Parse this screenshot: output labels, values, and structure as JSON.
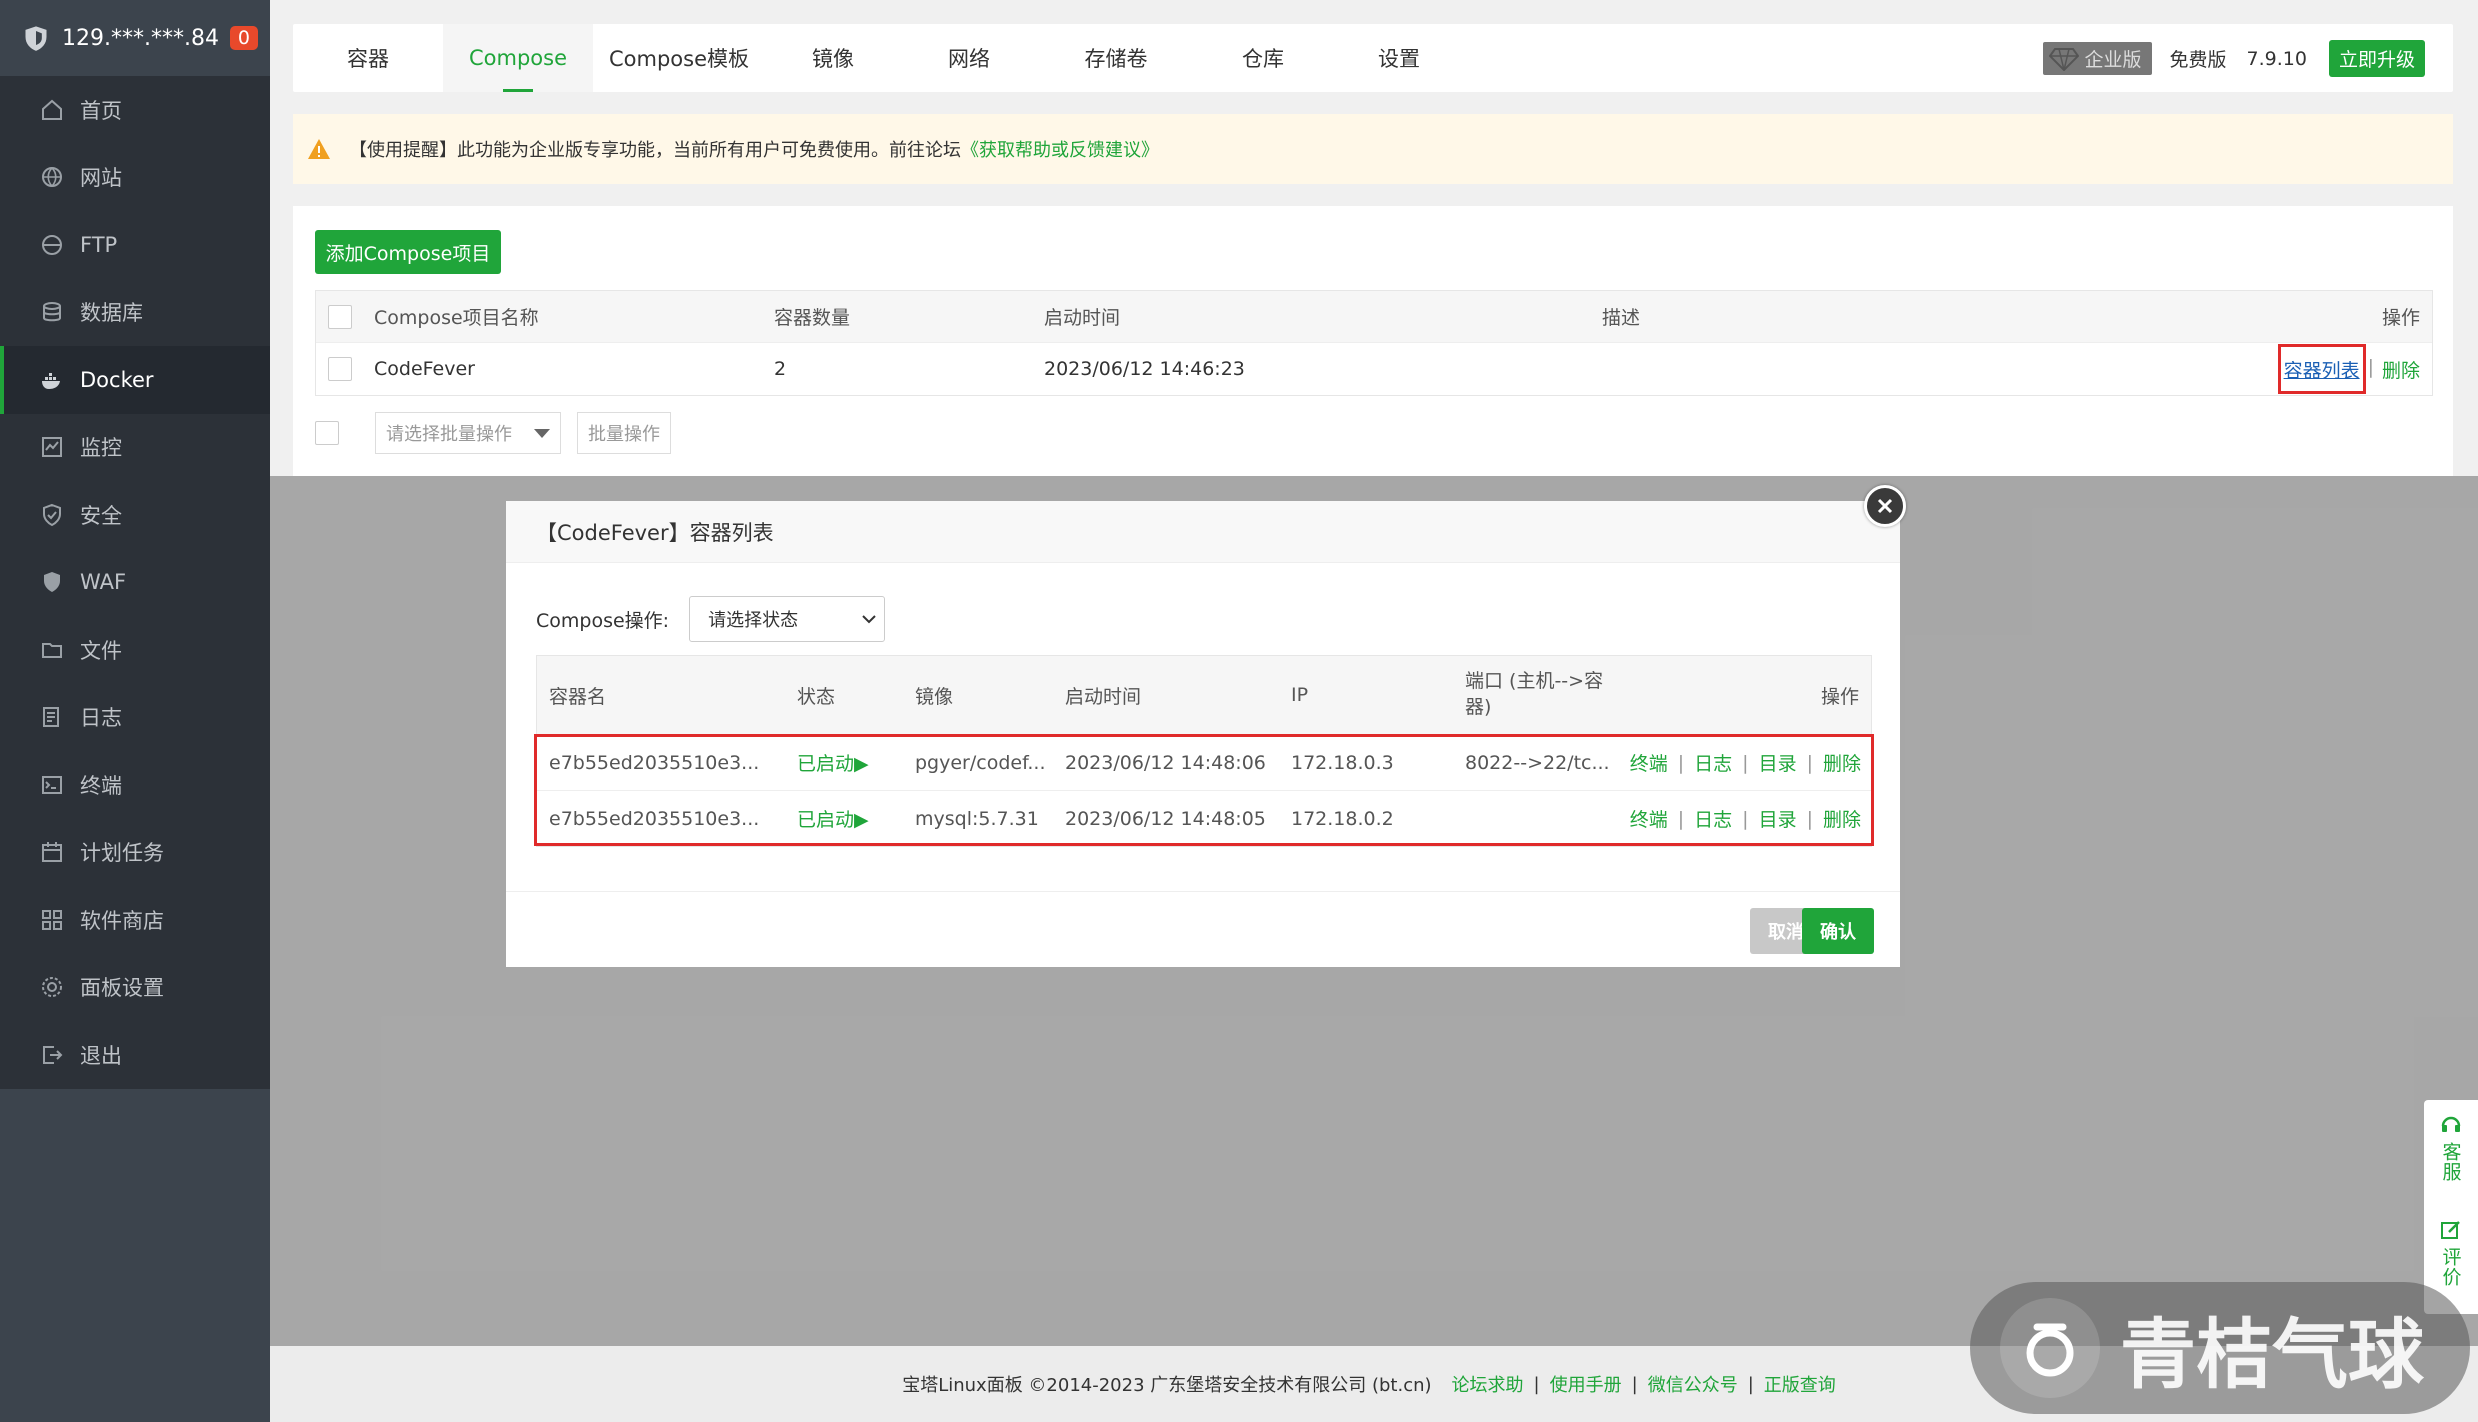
{
  "sidebar": {
    "server_ip": "129.***.***.84",
    "badge": "0",
    "items": [
      {
        "label": "首页",
        "icon": "home-icon"
      },
      {
        "label": "网站",
        "icon": "globe-icon"
      },
      {
        "label": "FTP",
        "icon": "ftp-icon"
      },
      {
        "label": "数据库",
        "icon": "database-icon"
      },
      {
        "label": "Docker",
        "icon": "docker-icon"
      },
      {
        "label": "监控",
        "icon": "monitor-icon"
      },
      {
        "label": "安全",
        "icon": "shield-check-icon"
      },
      {
        "label": "WAF",
        "icon": "waf-shield-icon"
      },
      {
        "label": "文件",
        "icon": "folder-icon"
      },
      {
        "label": "日志",
        "icon": "log-icon"
      },
      {
        "label": "终端",
        "icon": "terminal-icon"
      },
      {
        "label": "计划任务",
        "icon": "calendar-icon"
      },
      {
        "label": "软件商店",
        "icon": "apps-icon"
      },
      {
        "label": "面板设置",
        "icon": "settings-icon"
      },
      {
        "label": "退出",
        "icon": "logout-icon"
      }
    ],
    "active_index": 4
  },
  "tabs": [
    {
      "label": "容器"
    },
    {
      "label": "Compose"
    },
    {
      "label": "Compose模板"
    },
    {
      "label": "镜像"
    },
    {
      "label": "网络"
    },
    {
      "label": "存储卷"
    },
    {
      "label": "仓库"
    },
    {
      "label": "设置"
    }
  ],
  "active_tab": 1,
  "version": {
    "enterprise": "企业版",
    "free": "免费版",
    "number": "7.9.10",
    "upgrade": "立即升级"
  },
  "notice": {
    "text": "【使用提醒】此功能为企业版专享功能，当前所有用户可免费使用。前往论坛",
    "link": "《获取帮助或反馈建议》"
  },
  "compose": {
    "add_button": "添加Compose项目",
    "headers": {
      "name": "Compose项目名称",
      "count": "容器数量",
      "time": "启动时间",
      "desc": "描述",
      "ops": "操作"
    },
    "rows": [
      {
        "name": "CodeFever",
        "count": "2",
        "time": "2023/06/12 14:46:23",
        "desc": "",
        "op_list": "容器列表",
        "op_sep": "|",
        "op_delete": "删除"
      }
    ],
    "batch_select": "请选择批量操作",
    "batch_button": "批量操作"
  },
  "modal": {
    "title": "【CodeFever】容器列表",
    "op_label": "Compose操作:",
    "op_select": "请选择状态",
    "headers": {
      "name": "容器名",
      "status": "状态",
      "image": "镜像",
      "time": "启动时间",
      "ip": "IP",
      "port_line1": "端口 (主机-->容",
      "port_line2": "器)",
      "ops": "操作"
    },
    "rows": [
      {
        "name": "e7b55ed2035510e3...",
        "status": "已启动▶",
        "image": "pgyer/codef...",
        "time": "2023/06/12 14:48:06",
        "ip": "172.18.0.3",
        "port": "8022-->22/tc...",
        "op1": "终端",
        "op2": "日志",
        "op3": "目录",
        "op4": "删除"
      },
      {
        "name": "e7b55ed2035510e3...",
        "status": "已启动▶",
        "image": "mysql:5.7.31",
        "time": "2023/06/12 14:48:05",
        "ip": "172.18.0.2",
        "port": "",
        "op1": "终端",
        "op2": "日志",
        "op3": "目录",
        "op4": "删除"
      }
    ],
    "cancel": "取消",
    "confirm": "确认"
  },
  "footer": {
    "copyright": "宝塔Linux面板 ©2014-2023 广东堡塔安全技术有限公司 (bt.cn)",
    "links": [
      "论坛求助",
      "使用手册",
      "微信公众号",
      "正版查询"
    ],
    "sep": "|"
  },
  "side_help": {
    "service": "客服",
    "review": "评价"
  },
  "watermark": "青桔气球",
  "colors": {
    "accent": "#20a53a",
    "sidebar": "#2c3138",
    "highlight": "#e02a2a"
  }
}
